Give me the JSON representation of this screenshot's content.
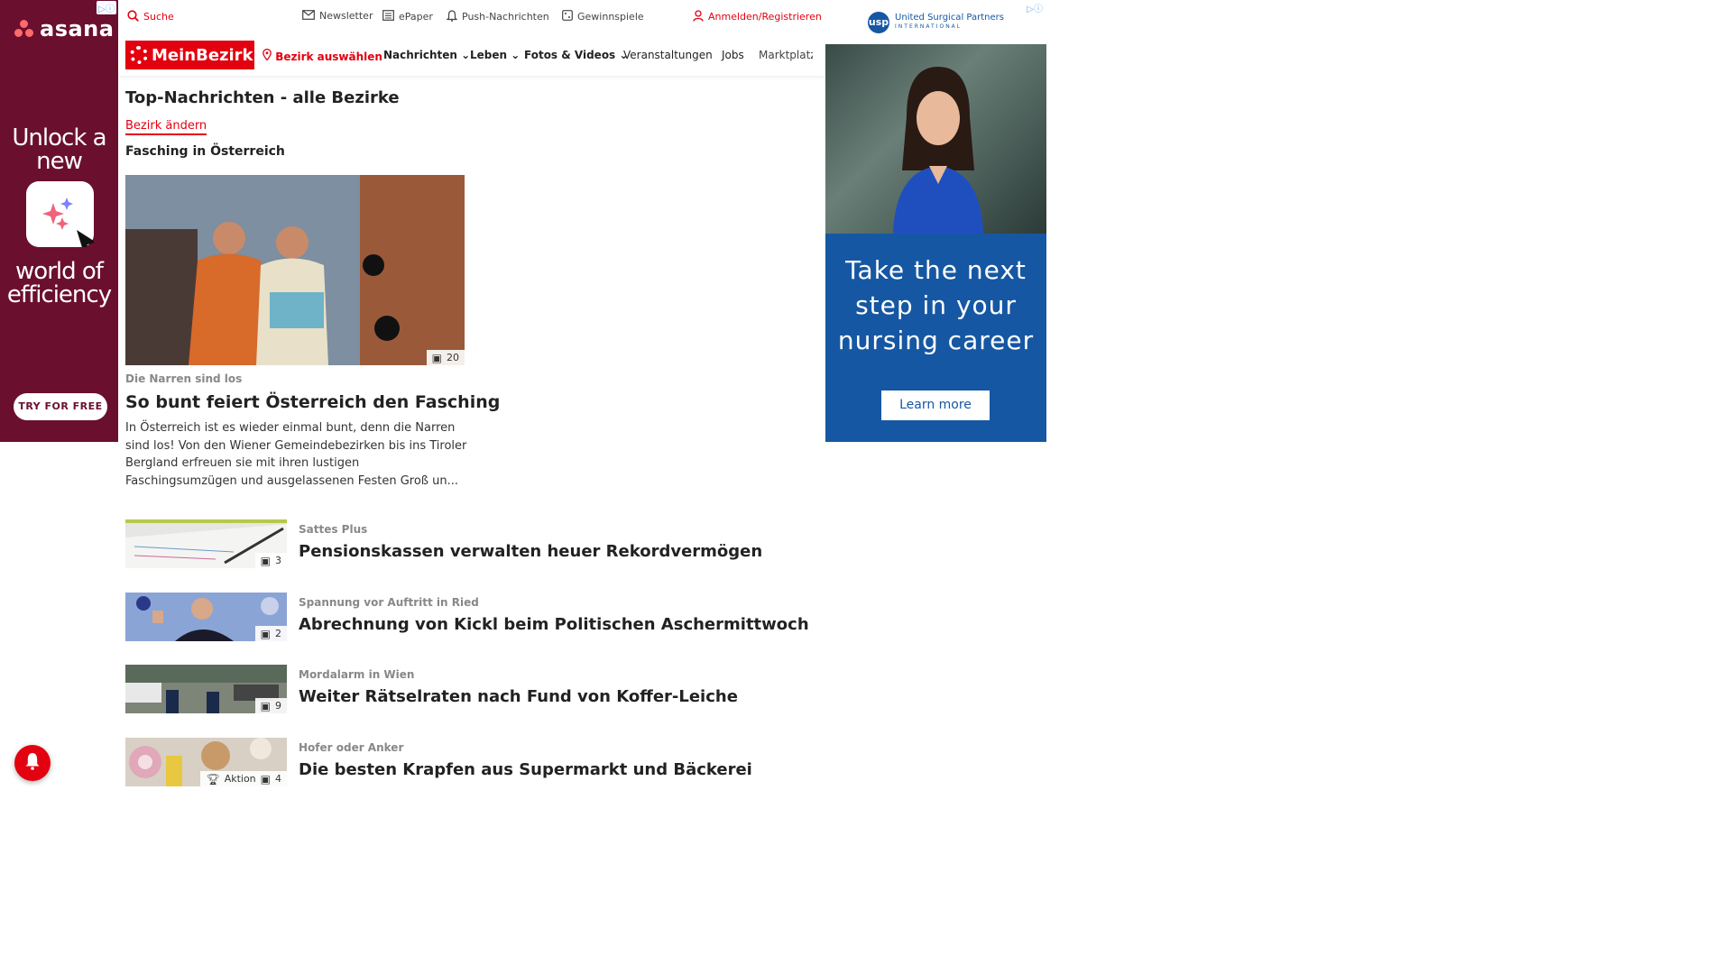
{
  "left_ad": {
    "adchoice": "▷ⓘ",
    "brand": "asana",
    "headline_1": "Unlock a new",
    "headline_2": "world of efficiency",
    "cta": "TRY FOR FREE"
  },
  "right_ad": {
    "adchoice": "▷ⓘ",
    "logo_mark": "usp",
    "logo_text": "United Surgical Partners",
    "logo_sub": "INTERNATIONAL",
    "tagline": "Take the next step in your nursing career",
    "cta": "Learn more"
  },
  "topbar": {
    "search": "Suche",
    "newsletter": "Newsletter",
    "epaper": "ePaper",
    "push": "Push-Nachrichten",
    "games": "Gewinnspiele",
    "login": "Anmelden/Registrieren"
  },
  "nav": {
    "logo": "MeinBezirk",
    "district": "Bezirk auswählen",
    "items": [
      "Nachrichten",
      "Leben",
      "Fotos & Videos",
      "Veranstaltungen",
      "Jobs",
      "Marktplatz"
    ]
  },
  "main": {
    "page_title": "Top-Nachrichten - alle Bezirke",
    "change_district": "Bezirk ändern",
    "section_title": "Fasching in Österreich",
    "hero": {
      "image_count": "20",
      "kicker": "Die Narren sind los",
      "title": "So bunt feiert Österreich den Fasching",
      "text": "In Österreich ist es wieder einmal bunt, denn die Narren sind los! Von den Wiener Gemeindebezirken bis ins Tiroler Bergland erfreuen sie mit ihren lustigen Faschingsumzügen und ausgelassenen Festen Groß un..."
    },
    "articles": [
      {
        "kicker": "Sattes Plus",
        "title": "Pensionskassen verwalten heuer Rekordvermögen",
        "image_count": "3"
      },
      {
        "kicker": "Spannung vor Auftritt in Ried",
        "title": "Abrechnung von Kickl beim Politischen Aschermittwoch",
        "image_count": "2"
      },
      {
        "kicker": "Mordalarm in Wien",
        "title": "Weiter Rätselraten nach Fund von Koffer-Leiche",
        "image_count": "9"
      },
      {
        "kicker": "Hofer oder Anker",
        "title": "Die besten Krapfen aus Supermarkt und Bäckerei",
        "image_count": "4",
        "badge_extra": "Aktion"
      }
    ]
  },
  "colors": {
    "brand_red": "#e3000f",
    "asana_bg": "#6b0f2f",
    "usp_blue": "#1657a3"
  }
}
